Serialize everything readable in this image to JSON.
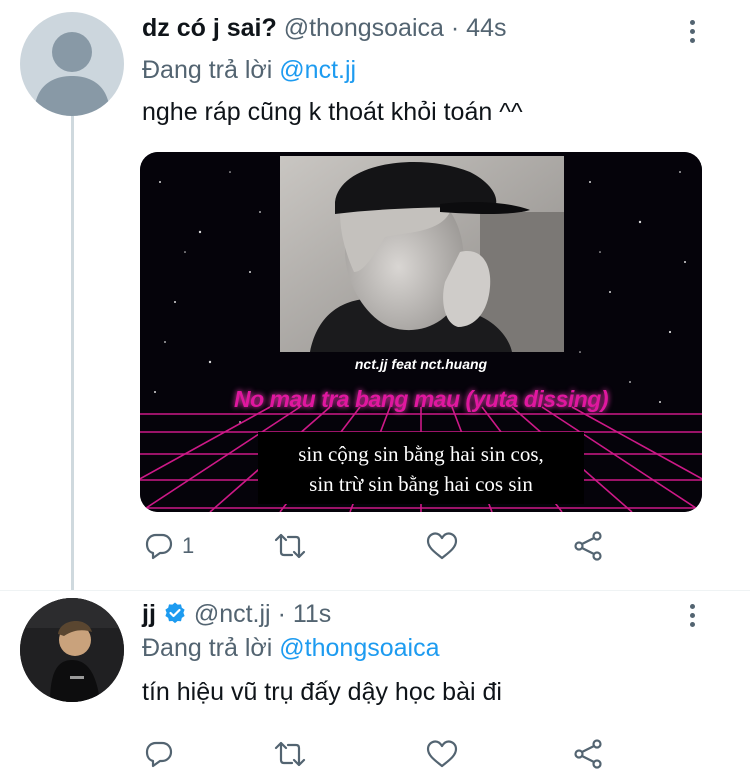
{
  "tweet1": {
    "display_name": "dz có j sai?",
    "handle": "@thongsoaica",
    "separator": "·",
    "time": "44s",
    "replying_prefix": "Đang trả lời",
    "replying_to": "@nct.jj",
    "text": "nghe ráp cũng k thoát khỏi toán ^^",
    "media": {
      "credit": "nct.jj feat nct.huang",
      "song_title": "No mau tra bang mau (yuta dissing)",
      "lyric_line1": "sin cộng sin bằng hai sin cos,",
      "lyric_line2": "sin trừ sin bằng hai cos sin"
    },
    "actions": {
      "reply_count": "1"
    }
  },
  "tweet2": {
    "display_name": "jj",
    "handle": "@nct.jj",
    "separator": "·",
    "time": "11s",
    "replying_prefix": "Đang trả lời",
    "replying_to": "@thongsoaica",
    "text": "tín hiệu vũ trụ đấy dậy học bài đi"
  },
  "colors": {
    "accent": "#1d9bf0",
    "secondary_text": "#536471",
    "primary_text": "#0f1419",
    "neon_pink": "#e0179f"
  },
  "icons": [
    "reply-icon",
    "retweet-icon",
    "like-icon",
    "share-icon",
    "more-icon",
    "verified-badge-icon"
  ]
}
